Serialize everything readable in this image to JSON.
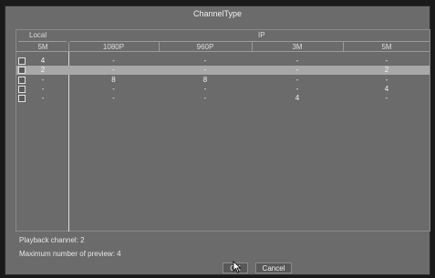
{
  "dialog": {
    "title": "ChannelType"
  },
  "table": {
    "groups": {
      "local": "Local",
      "ip": "IP"
    },
    "columns": {
      "local_5m": "5M",
      "ip_1080p": "1080P",
      "ip_960p": "960P",
      "ip_3m": "3M",
      "ip_5m": "5M"
    },
    "rows": [
      {
        "local_5m": "4",
        "ip_1080p": "-",
        "ip_960p": "-",
        "ip_3m": "-",
        "ip_5m": "-",
        "selected": false
      },
      {
        "local_5m": "2",
        "ip_1080p": "-",
        "ip_960p": "-",
        "ip_3m": "-",
        "ip_5m": "2",
        "selected": true
      },
      {
        "local_5m": "-",
        "ip_1080p": "8",
        "ip_960p": "8",
        "ip_3m": "-",
        "ip_5m": "-",
        "selected": false
      },
      {
        "local_5m": "-",
        "ip_1080p": "-",
        "ip_960p": "-",
        "ip_3m": "-",
        "ip_5m": "4",
        "selected": false
      },
      {
        "local_5m": "-",
        "ip_1080p": "-",
        "ip_960p": "-",
        "ip_3m": "4",
        "ip_5m": "-",
        "selected": false
      }
    ]
  },
  "info": {
    "playback": "Playback channel: 2",
    "max_preview": "Maximum number of preview: 4"
  },
  "buttons": {
    "ok": "OK",
    "cancel": "Cancel"
  },
  "colors": {
    "dialog_bg": "#6b6b6b",
    "selected_row": "#a8a8a8"
  },
  "icons": {
    "cursor": "mouse-pointer-icon",
    "checkbox": "checkbox-icon"
  }
}
